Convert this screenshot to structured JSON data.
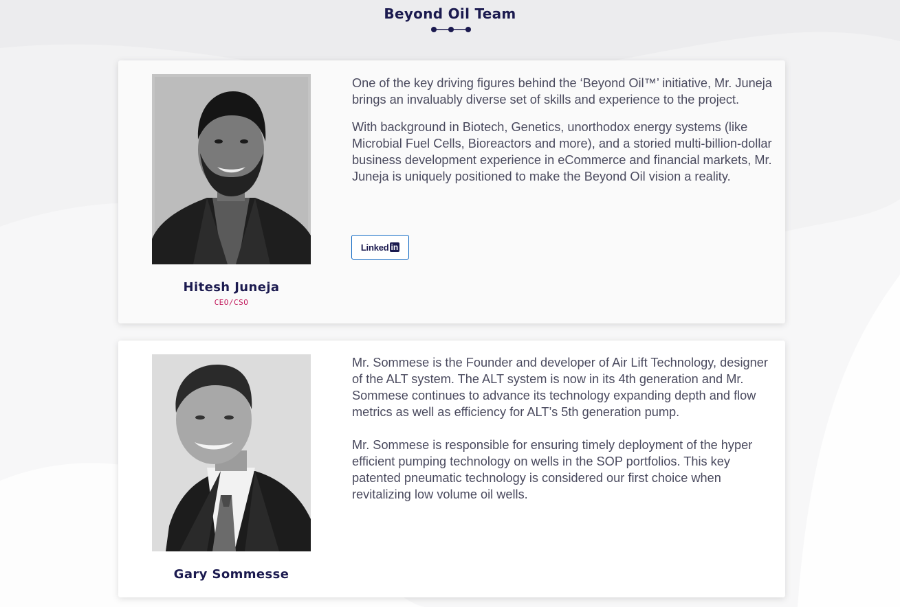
{
  "section": {
    "title": "Beyond Oil Team"
  },
  "colors": {
    "title": "#1b1a4f",
    "role": "#c2185b",
    "body_text": "#4a4a5e",
    "linkedin_border": "#0b66c2"
  },
  "team": [
    {
      "name": "Hitesh Juneja",
      "role": "CEO/CSO",
      "photo_icon": "portrait-photo",
      "bio": [
        "One of the key driving figures behind the ‘Beyond Oil™’ initiative, Mr. Juneja brings an invaluably diverse set of skills and experience to the project.",
        "With background in Biotech, Genetics, unorthodox energy systems (like Microbial Fuel Cells, Bioreactors and more), and a storied multi-billion-dollar business development experience in eCommerce and financial markets, Mr. Juneja is uniquely positioned to make the Beyond Oil vision a reality."
      ],
      "linkedin": {
        "label": "Linked",
        "badge": "in"
      }
    },
    {
      "name": "Gary Sommesse",
      "photo_icon": "portrait-photo",
      "bio": [
        "Mr. Sommese is the Founder and developer of Air Lift Technology, designer of the ALT system. The ALT system is now in its 4th generation and Mr. Sommese continues to advance its technology expanding depth and flow metrics as well as efficiency for ALT’s 5th generation pump.",
        "Mr. Sommese is responsible for ensuring timely deployment of the hyper efficient pumping technology on wells in the SOP portfolios. This key patented pneumatic technology is considered our first choice when revitalizing low volume oil wells."
      ]
    }
  ]
}
